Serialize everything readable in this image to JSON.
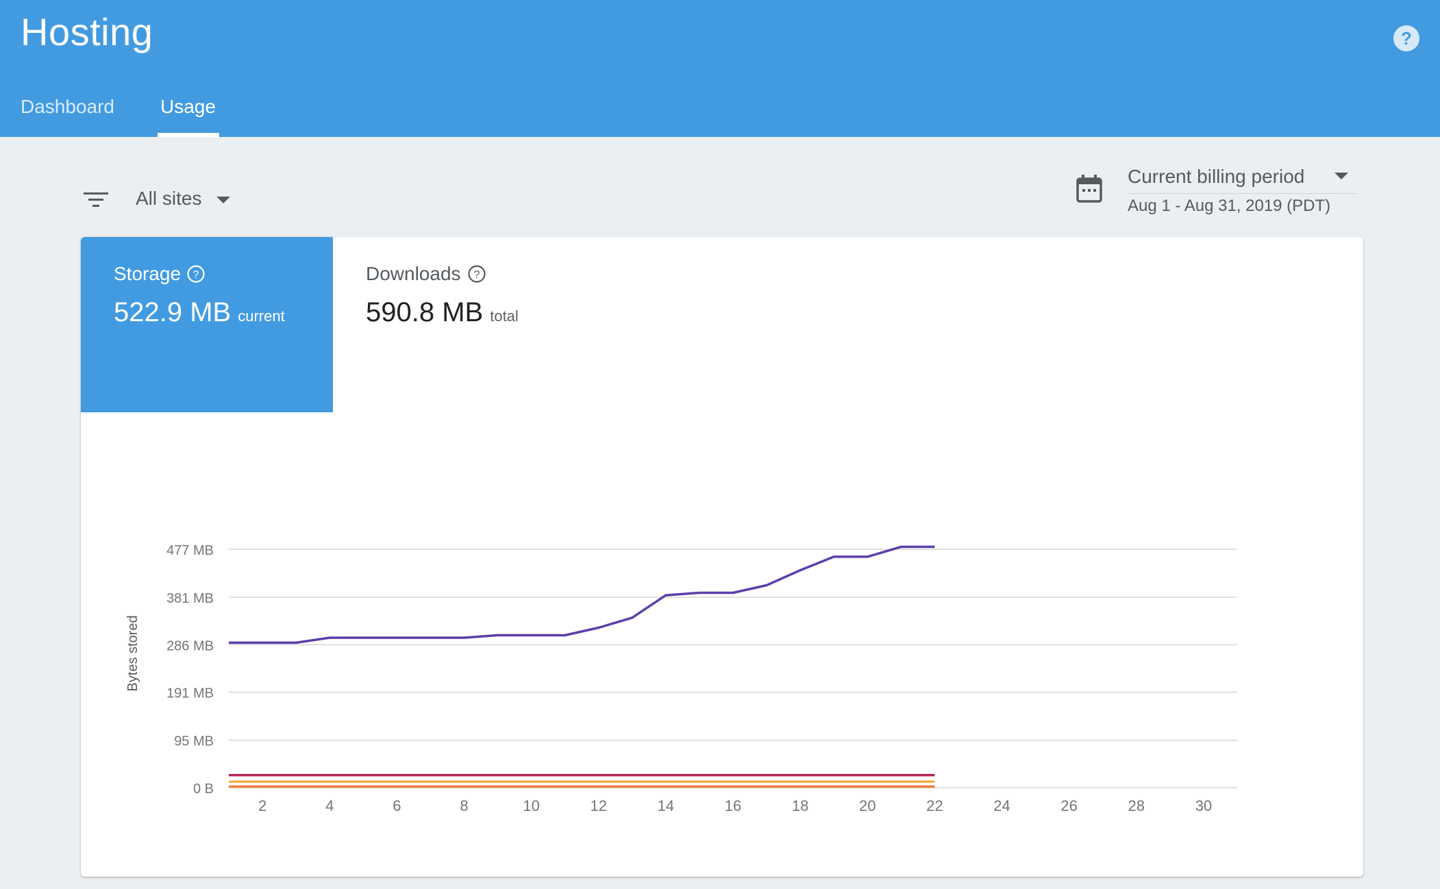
{
  "header": {
    "title": "Hosting",
    "help_icon": "help-circle-icon",
    "tabs": [
      {
        "label": "Dashboard",
        "active": false
      },
      {
        "label": "Usage",
        "active": true
      }
    ],
    "color": "#429be1"
  },
  "filters": {
    "filter_icon": "filter-list-icon",
    "sites": "All sites"
  },
  "period": {
    "calendar_icon": "calendar-icon",
    "selected": "Current billing period",
    "range": "Aug 1 - Aug 31, 2019 (PDT)"
  },
  "metrics": {
    "storage": {
      "label": "Storage",
      "value": "522.9 MB",
      "unit": "current",
      "selected": true
    },
    "downloads": {
      "label": "Downloads",
      "value": "590.8 MB",
      "unit": "total",
      "selected": false
    }
  },
  "chart_data": {
    "type": "line",
    "ylabel": "Bytes stored",
    "xlabel": "",
    "y_tick_labels": [
      "0 B",
      "95 MB",
      "191 MB",
      "286 MB",
      "381 MB",
      "477 MB"
    ],
    "y_tick_values": [
      0,
      95,
      191,
      286,
      381,
      477
    ],
    "x_ticks": [
      2,
      4,
      6,
      8,
      10,
      12,
      14,
      16,
      18,
      20,
      22,
      24,
      26,
      28,
      30
    ],
    "xlim": [
      1,
      31
    ],
    "ylim": [
      0,
      477
    ],
    "grid": true,
    "legend": "none",
    "series": [
      {
        "color": "#5c3fa8",
        "x": [
          1,
          2,
          3,
          4,
          5,
          6,
          7,
          8,
          9,
          10,
          11,
          12,
          13,
          14,
          15,
          16,
          17,
          18,
          19,
          20,
          21,
          22
        ],
        "y": [
          290,
          290,
          290,
          300,
          300,
          300,
          300,
          300,
          305,
          305,
          305,
          320,
          340,
          385,
          390,
          390,
          405,
          435,
          462,
          462,
          482,
          482
        ]
      },
      {
        "color": "#b8245c",
        "x": [
          1,
          22
        ],
        "y": [
          25,
          25
        ]
      },
      {
        "color": "#f5b14a",
        "x": [
          1,
          22
        ],
        "y": [
          12,
          12
        ]
      },
      {
        "color": "#ef7d3c",
        "x": [
          1,
          22
        ],
        "y": [
          2,
          2
        ]
      }
    ]
  }
}
